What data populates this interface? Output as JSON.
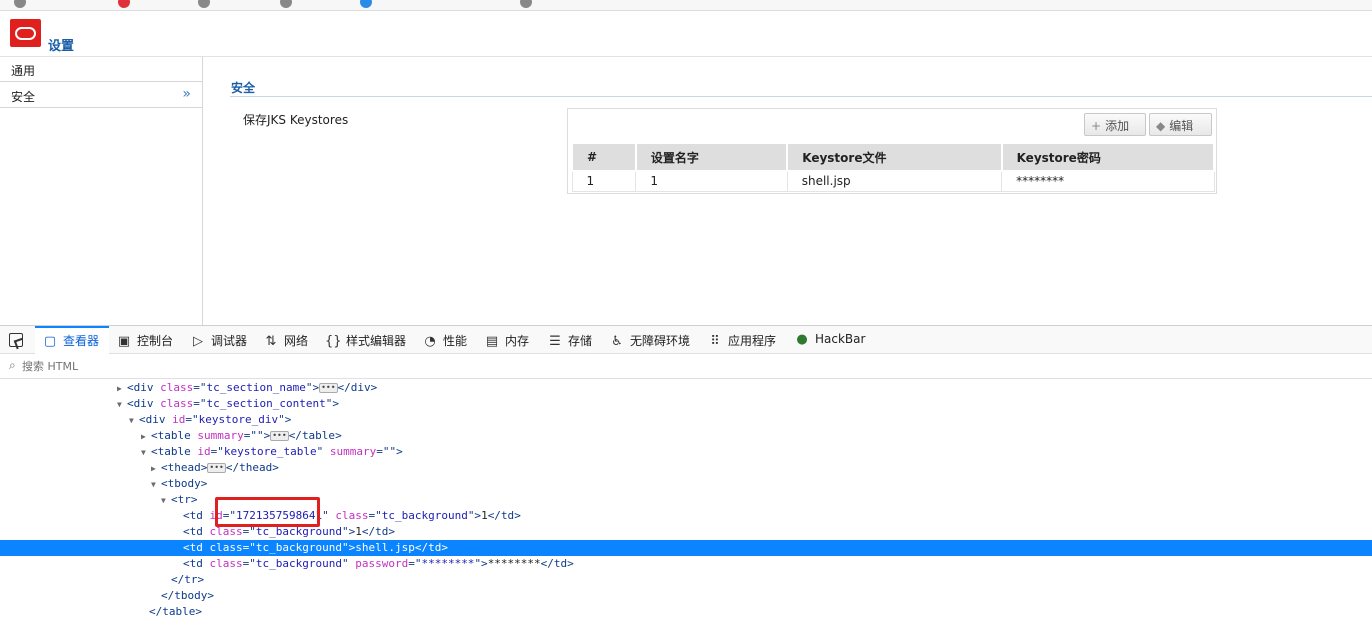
{
  "app": {
    "title": "设置"
  },
  "sidebar": {
    "items": [
      {
        "label": "通用"
      },
      {
        "label": "安全",
        "selected": true
      }
    ]
  },
  "content": {
    "section_title": "安全",
    "keystores_label": "保存JKS Keystores",
    "toolbar": {
      "add_label": "添加",
      "edit_label": "编辑"
    },
    "table": {
      "headers": [
        "#",
        "设置名字",
        "Keystore文件",
        "Keystore密码"
      ],
      "rows": [
        [
          "1",
          "1",
          "shell.jsp",
          "********"
        ]
      ]
    }
  },
  "devtools": {
    "tabs": [
      {
        "label": "查看器",
        "icon": "inspector-icon",
        "active": true
      },
      {
        "label": "控制台",
        "icon": "console-icon"
      },
      {
        "label": "调试器",
        "icon": "debugger-icon"
      },
      {
        "label": "网络",
        "icon": "network-icon"
      },
      {
        "label": "样式编辑器",
        "icon": "style-editor-icon"
      },
      {
        "label": "性能",
        "icon": "performance-icon"
      },
      {
        "label": "内存",
        "icon": "memory-icon"
      },
      {
        "label": "存储",
        "icon": "storage-icon"
      },
      {
        "label": "无障碍环境",
        "icon": "accessibility-icon"
      },
      {
        "label": "应用程序",
        "icon": "application-icon"
      },
      {
        "label": "HackBar",
        "icon": "hackbar-icon"
      }
    ],
    "search_placeholder": "搜索 HTML",
    "dom": {
      "l1": {
        "tag": "div",
        "attr": "class",
        "val": "tc_section_name"
      },
      "l2": {
        "tag": "div",
        "attr": "class",
        "val": "tc_section_content"
      },
      "l3": {
        "tag": "div",
        "attr": "id",
        "val": "keystore_div"
      },
      "l4": {
        "tag": "table",
        "attr": "summary",
        "val": ""
      },
      "l5": {
        "tag": "table",
        "attr": "id",
        "val": "keystore_table",
        "attr2": "summary",
        "val2": ""
      },
      "l6": {
        "tag": "thead"
      },
      "l7": {
        "tag": "tbody"
      },
      "l8": {
        "tag": "tr"
      },
      "l9": {
        "tag": "td",
        "attr": "id",
        "val": "1721357598641",
        "attr2": "class",
        "val2": "tc_background",
        "text": "1"
      },
      "l10": {
        "tag": "td",
        "attr": "class",
        "val": "tc_background",
        "text": "1"
      },
      "l11": {
        "tag": "td",
        "attr": "class",
        "val": "tc_background",
        "text": "shell.jsp"
      },
      "l12": {
        "tag": "td",
        "attr": "class",
        "val": "tc_background",
        "attr2": "password",
        "val2": "********",
        "text": "********"
      },
      "l13": {
        "tag": "tr"
      },
      "l14": {
        "tag": "tbody"
      },
      "l15": {
        "tag": "table"
      }
    }
  },
  "colors": {
    "accent": "#0a84ff",
    "brand": "#e01f1f",
    "annotation": "#e0201f"
  }
}
